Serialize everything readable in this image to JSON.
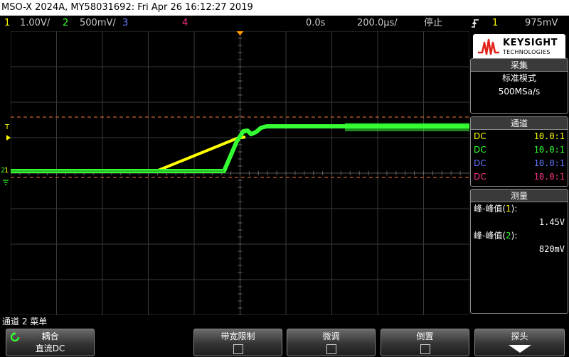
{
  "title_bar": "MSO-X 2024A, MY58031692: Fri Apr 26 16:12:27 2019",
  "status": {
    "ch1_num": "1",
    "ch1_scale": "1.00V/",
    "ch2_num": "2",
    "ch2_scale": "500mV/",
    "ch3_num": "3",
    "ch4_num": "4",
    "delay": "0.0s",
    "timebase": "200.0μs/",
    "run_state": "停止",
    "trigger_icon": "trigger-edge-rising",
    "trigger_ch": "1",
    "trigger_level": "975mV"
  },
  "colors": {
    "ch1": "#ffff00",
    "ch2": "#33ff33",
    "ch3": "#6677ff",
    "ch4": "#ff3388",
    "trigger_marker": "#ff9900",
    "cursor_line": "#ff7733",
    "grid": "#3a3a3a"
  },
  "screen_markers": {
    "trigger_level_label": "T",
    "ch2_ground": "2",
    "ch1_ground": "1"
  },
  "brand": {
    "name": "KEYSIGHT",
    "sub": "TECHNOLOGIES"
  },
  "acquire": {
    "header": "采集",
    "mode": "标准模式",
    "rate": "500MSa/s"
  },
  "channels": {
    "header": "通道",
    "rows": [
      {
        "coupling": "DC",
        "probe": "10.0:1"
      },
      {
        "coupling": "DC",
        "probe": "10.0:1"
      },
      {
        "coupling": "DC",
        "probe": "10.0:1"
      },
      {
        "coupling": "DC",
        "probe": "10.0:1"
      }
    ]
  },
  "measure": {
    "header": "测量",
    "m1_label": "峰-峰值",
    "m1_ch": "1",
    "m1_value": "1.45V",
    "m2_label": "峰-峰值",
    "m2_ch": "2",
    "m2_value": "820mV"
  },
  "menu": {
    "title": "通道 2 菜单",
    "coupling_label": "耦合",
    "coupling_value": "直流DC",
    "bw_limit": "带宽限制",
    "fine": "微调",
    "invert": "倒置",
    "probe": "探头"
  }
}
